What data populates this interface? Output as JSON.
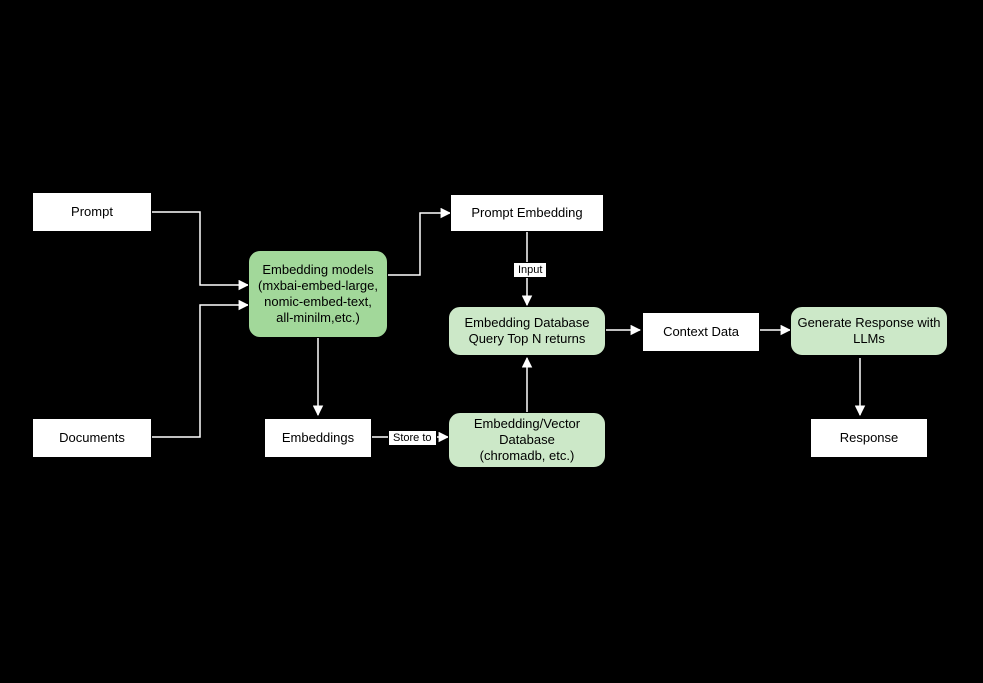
{
  "nodes": {
    "prompt": "Prompt",
    "documents": "Documents",
    "embedding_models": "Embedding models\n(mxbai-embed-large,\nnomic-embed-text,\nall-minilm,etc.)",
    "embeddings": "Embeddings",
    "prompt_embedding": "Prompt Embedding",
    "query_topn": "Embedding Database\nQuery Top N returns",
    "vector_db": "Embedding/Vector\nDatabase\n(chromadb, etc.)",
    "context_data": "Context Data",
    "generate_llm": "Generate Response with\nLLMs",
    "response": "Response"
  },
  "edge_labels": {
    "input": "Input",
    "store_to": "Store to"
  }
}
